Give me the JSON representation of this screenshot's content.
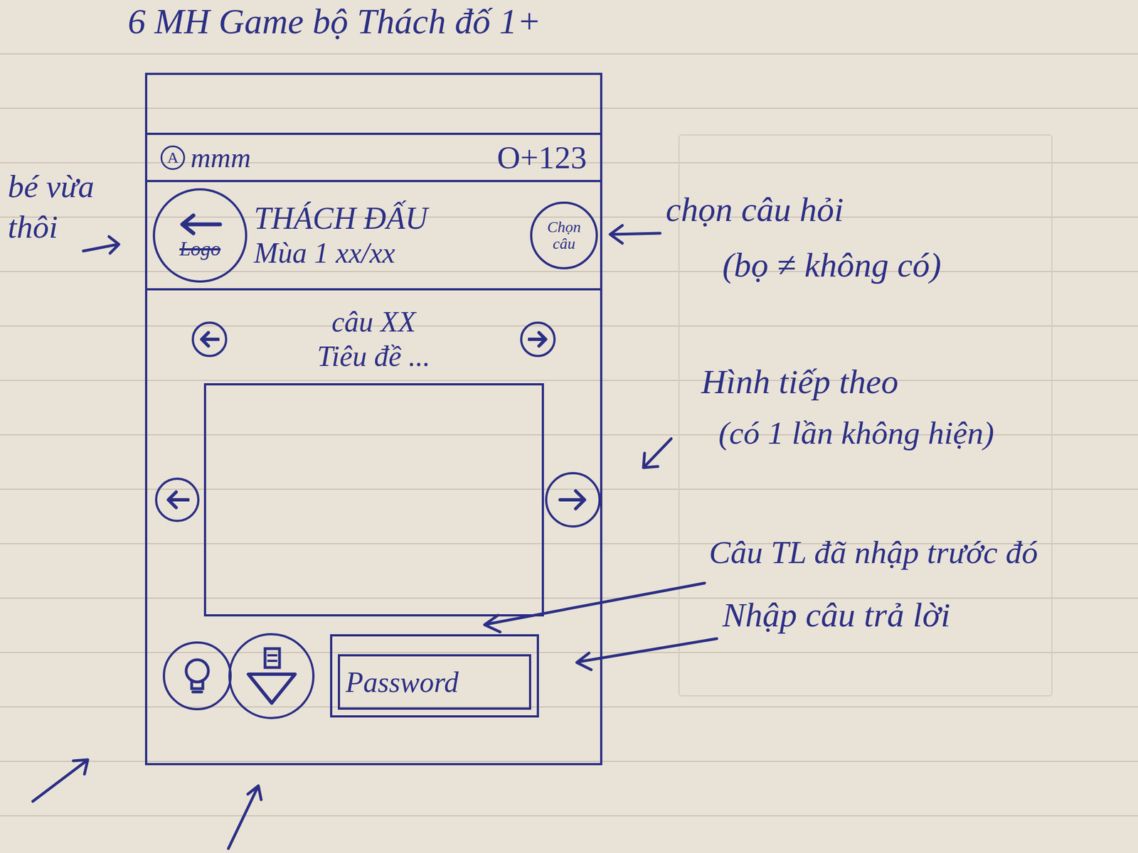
{
  "page_heading": "6   MH Game bộ Thách đố 1+",
  "side_note": {
    "line1": "bé vừa",
    "line2": "thôi"
  },
  "phone": {
    "status_bar": {
      "badge": "A",
      "signal": "mmm",
      "battery": "O+123"
    },
    "header": {
      "logo": {
        "text": "Logo",
        "struck": true
      },
      "title": "THÁCH ĐẤU",
      "subtitle": "Mùa 1 xx/xx",
      "pick_button": "Chọn câu"
    },
    "question": {
      "number": "câu XX",
      "title": "Tiêu đề ..."
    },
    "answer_field": {
      "placeholder": "Password"
    }
  },
  "notes": [
    {
      "text": "chọn câu hỏi"
    },
    {
      "text": "(bọ ≠ không có)"
    },
    {
      "text": "Hình tiếp theo"
    },
    {
      "text": "(có 1 lần không hiện)"
    },
    {
      "text": "Câu TL đã nhập trước đó"
    },
    {
      "text": "Nhập câu trả lời"
    }
  ]
}
